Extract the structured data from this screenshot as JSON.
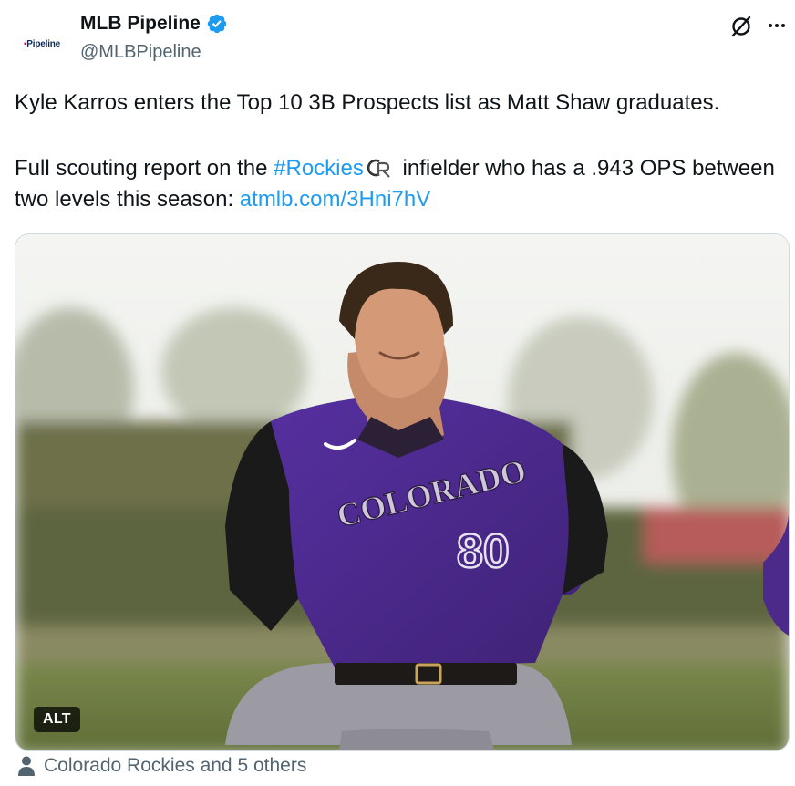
{
  "account": {
    "display_name": "MLB Pipeline",
    "handle": "@MLBPipeline",
    "avatar_text": "Pipeline",
    "avatar_mark": "▪"
  },
  "tweet": {
    "line1": "Kyle Karros enters the Top 10 3B Prospects list as Matt Shaw graduates.",
    "line2_prefix": "Full scouting report on the ",
    "hashtag": "#Rockies",
    "line2_suffix": " infielder who has a .943 OPS between two levels this season: ",
    "link": "atmlb.com/3Hni7hV"
  },
  "media": {
    "alt_label": "ALT",
    "jersey_text": "COLORADO",
    "jersey_number": "80"
  },
  "tagged": {
    "label": "Colorado Rockies and 5 others"
  },
  "colors": {
    "link": "#1d9bf0",
    "verified": "#1d9bf0",
    "jersey": "#4b2a8a",
    "secondary_text": "#536471"
  }
}
